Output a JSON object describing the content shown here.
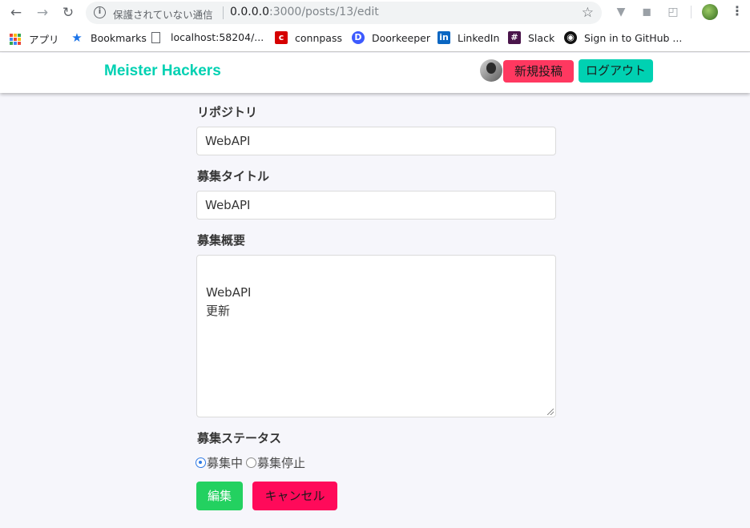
{
  "browser": {
    "security_label": "保護されていない通信",
    "url_host": "0.0.0.0",
    "url_rest": ":3000/posts/13/edit",
    "bookmarks": [
      {
        "label": "アプリ",
        "icon": "apps-grid-icon"
      },
      {
        "label": "Bookmarks",
        "icon": "star-icon"
      },
      {
        "label": "localhost:58204/...",
        "icon": "page-icon"
      },
      {
        "label": "connpass",
        "icon": "connpass-icon"
      },
      {
        "label": "Doorkeeper",
        "icon": "doorkeeper-icon"
      },
      {
        "label": "LinkedIn",
        "icon": "linkedin-icon"
      },
      {
        "label": "Slack",
        "icon": "slack-icon"
      },
      {
        "label": "Sign in to GitHub ...",
        "icon": "github-icon"
      }
    ]
  },
  "header": {
    "brand": "Meister Hackers",
    "new_post": "新規投稿",
    "logout": "ログアウト"
  },
  "form": {
    "repo_label": "リポジトリ",
    "repo_value": "WebAPI",
    "title_label": "募集タイトル",
    "title_value": "WebAPI",
    "summary_label": "募集概要",
    "summary_value": "WebAPI\n更新",
    "status_label": "募集ステータス",
    "status_options": [
      "募集中",
      "募集停止"
    ],
    "status_selected": "募集中",
    "submit_label": "編集",
    "cancel_label": "キャンセル"
  },
  "colors": {
    "brand": "#00d1b2",
    "new_post": "#ff3860",
    "submit": "#23d160",
    "cancel": "#ff0a5a"
  }
}
